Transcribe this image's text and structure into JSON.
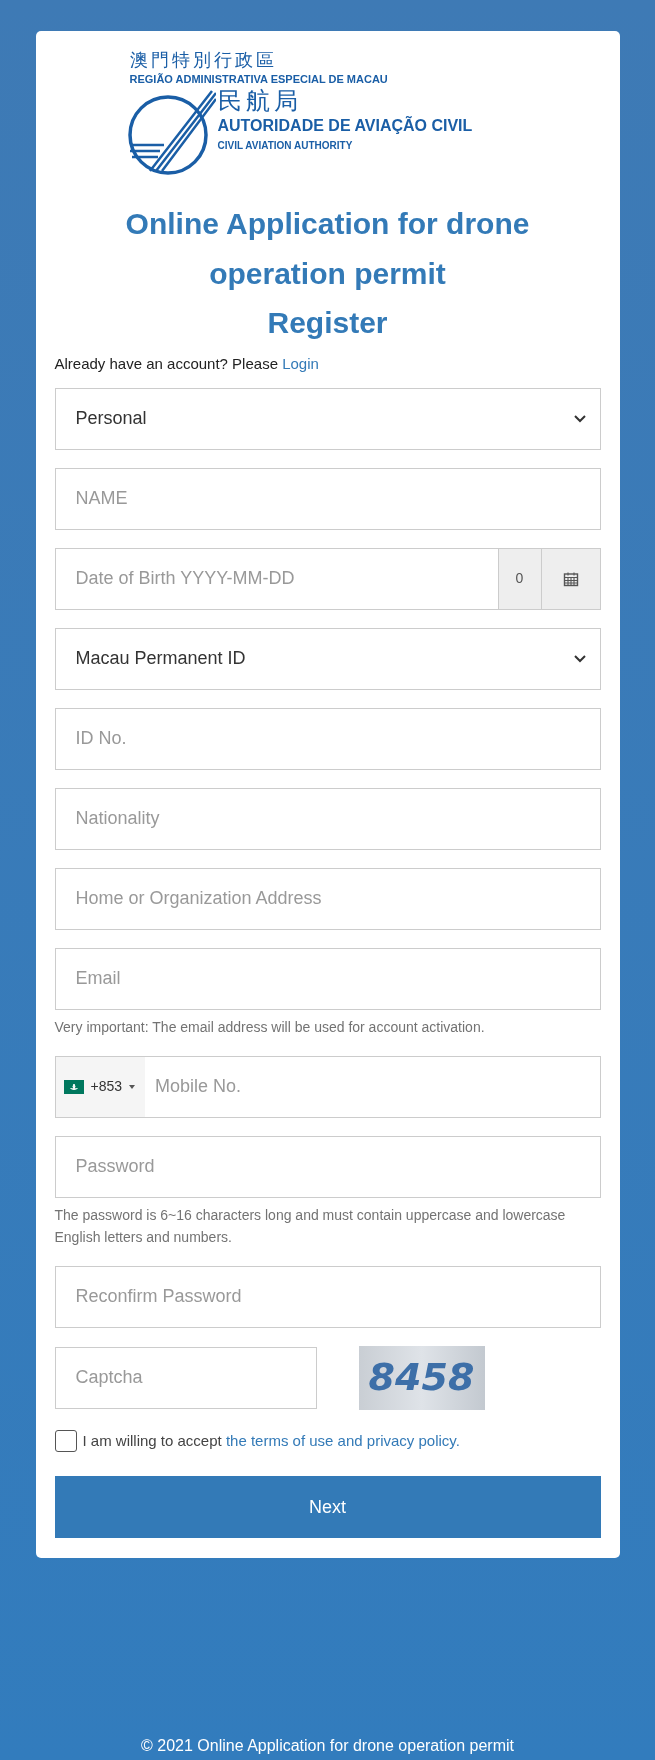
{
  "logo": {
    "region_zh": "澳門特別行政區",
    "region_pt": "REGIÃO ADMINISTRATIVA ESPECIAL DE MACAU",
    "agency_zh": "民航局",
    "agency_pt": "AUTORIDADE DE AVIAÇÃO CIVIL",
    "agency_en": "CIVIL AVIATION AUTHORITY"
  },
  "title": "Online Application for drone operation permit",
  "subtitle": "Register",
  "login_prompt": {
    "text": "Already have an account? Please",
    "link": "Login"
  },
  "fields": [
    {
      "kind": "select",
      "value": "Personal"
    },
    {
      "kind": "text",
      "placeholder": "NAME"
    },
    {
      "kind": "date",
      "placeholder": "Date of Birth YYYY-MM-DD",
      "addon": "0"
    },
    {
      "kind": "select",
      "value": "Macau Permanent ID"
    },
    {
      "kind": "text",
      "placeholder": "ID No."
    },
    {
      "kind": "text",
      "placeholder": "Nationality"
    },
    {
      "kind": "text",
      "placeholder": "Home or Organization Address"
    },
    {
      "kind": "text",
      "placeholder": "Email",
      "note": "Very important: The email address will be used for account activation."
    },
    {
      "kind": "phone",
      "placeholder": "Mobile No.",
      "code": "+853"
    },
    {
      "kind": "text",
      "placeholder": "Password",
      "note": "The password is 6~16 characters long and must contain uppercase and lowercase English letters and numbers."
    },
    {
      "kind": "text",
      "placeholder": "Reconfirm Password"
    },
    {
      "kind": "captcha",
      "placeholder": "Captcha",
      "image_text": "8458"
    }
  ],
  "terms": {
    "checked": false,
    "text": "I am willing to accept",
    "link": "the terms of use and privacy policy."
  },
  "submit": "Next",
  "footer": "© 2021 Online Application for drone operation permit"
}
